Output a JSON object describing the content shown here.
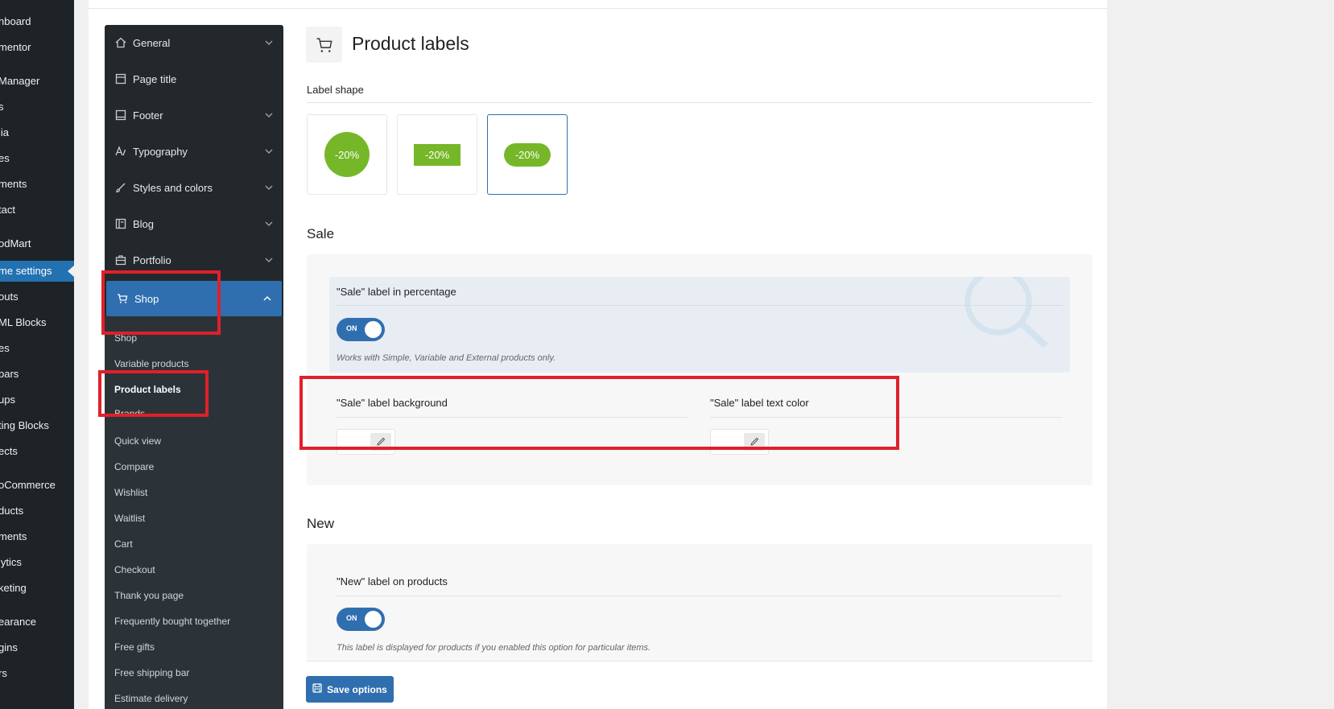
{
  "wp_menu": {
    "items": [
      {
        "label": "hboard"
      },
      {
        "label": "mentor"
      },
      {
        "label": "Manager"
      },
      {
        "label": "s"
      },
      {
        "label": "lia"
      },
      {
        "label": "es"
      },
      {
        "label": "ments"
      },
      {
        "label": "tact"
      },
      {
        "label": "odMart"
      },
      {
        "label": "me settings"
      },
      {
        "label": "outs"
      },
      {
        "label": "ML Blocks"
      },
      {
        "label": "es"
      },
      {
        "label": "bars"
      },
      {
        "label": "ups"
      },
      {
        "label": "ting Blocks"
      },
      {
        "label": "ects"
      },
      {
        "label": "oCommerce"
      },
      {
        "label": "ducts"
      },
      {
        "label": "ments"
      },
      {
        "label": "lytics"
      },
      {
        "label": "keting"
      },
      {
        "label": "earance"
      },
      {
        "label": "gins"
      },
      {
        "label": "rs"
      }
    ]
  },
  "theme_nav": {
    "items": [
      {
        "label": "General",
        "icon": "home-icon"
      },
      {
        "label": "Page title",
        "icon": "page-icon"
      },
      {
        "label": "Footer",
        "icon": "footer-icon"
      },
      {
        "label": "Typography",
        "icon": "typography-icon"
      },
      {
        "label": "Styles and colors",
        "icon": "brush-icon"
      },
      {
        "label": "Blog",
        "icon": "blog-icon"
      },
      {
        "label": "Portfolio",
        "icon": "portfolio-icon"
      },
      {
        "label": "Shop",
        "icon": "cart-icon"
      }
    ],
    "sub_items": [
      {
        "label": "Shop"
      },
      {
        "label": "Variable products"
      },
      {
        "label": "Product labels"
      },
      {
        "label": "Brands"
      },
      {
        "label": "Quick view"
      },
      {
        "label": "Compare"
      },
      {
        "label": "Wishlist"
      },
      {
        "label": "Waitlist"
      },
      {
        "label": "Cart"
      },
      {
        "label": "Checkout"
      },
      {
        "label": "Thank you page"
      },
      {
        "label": "Frequently bought together"
      },
      {
        "label": "Free gifts"
      },
      {
        "label": "Free shipping bar"
      },
      {
        "label": "Estimate delivery"
      }
    ]
  },
  "page": {
    "title": "Product labels",
    "label_shape": {
      "label": "Label shape",
      "options": [
        {
          "text": "-20%",
          "shape": "circle"
        },
        {
          "text": "-20%",
          "shape": "rectangle"
        },
        {
          "text": "-20%",
          "shape": "rounded"
        }
      ],
      "selected": "rounded"
    },
    "sale": {
      "title": "Sale",
      "percentage_label": "\"Sale\" label in percentage",
      "percentage_toggle": "ON",
      "percentage_hint": "Works with Simple, Variable and External products only.",
      "bg_label": "\"Sale\" label background",
      "text_color_label": "\"Sale\" label text color"
    },
    "new": {
      "title": "New",
      "products_label": "\"New\" label on products",
      "toggle": "ON",
      "hint": "This label is displayed for products if you enabled this option for particular items."
    },
    "save_button": "Save options"
  },
  "colors": {
    "accent": "#2f6fb0",
    "label_green": "#76b729",
    "annotation_red": "#e0202a"
  }
}
